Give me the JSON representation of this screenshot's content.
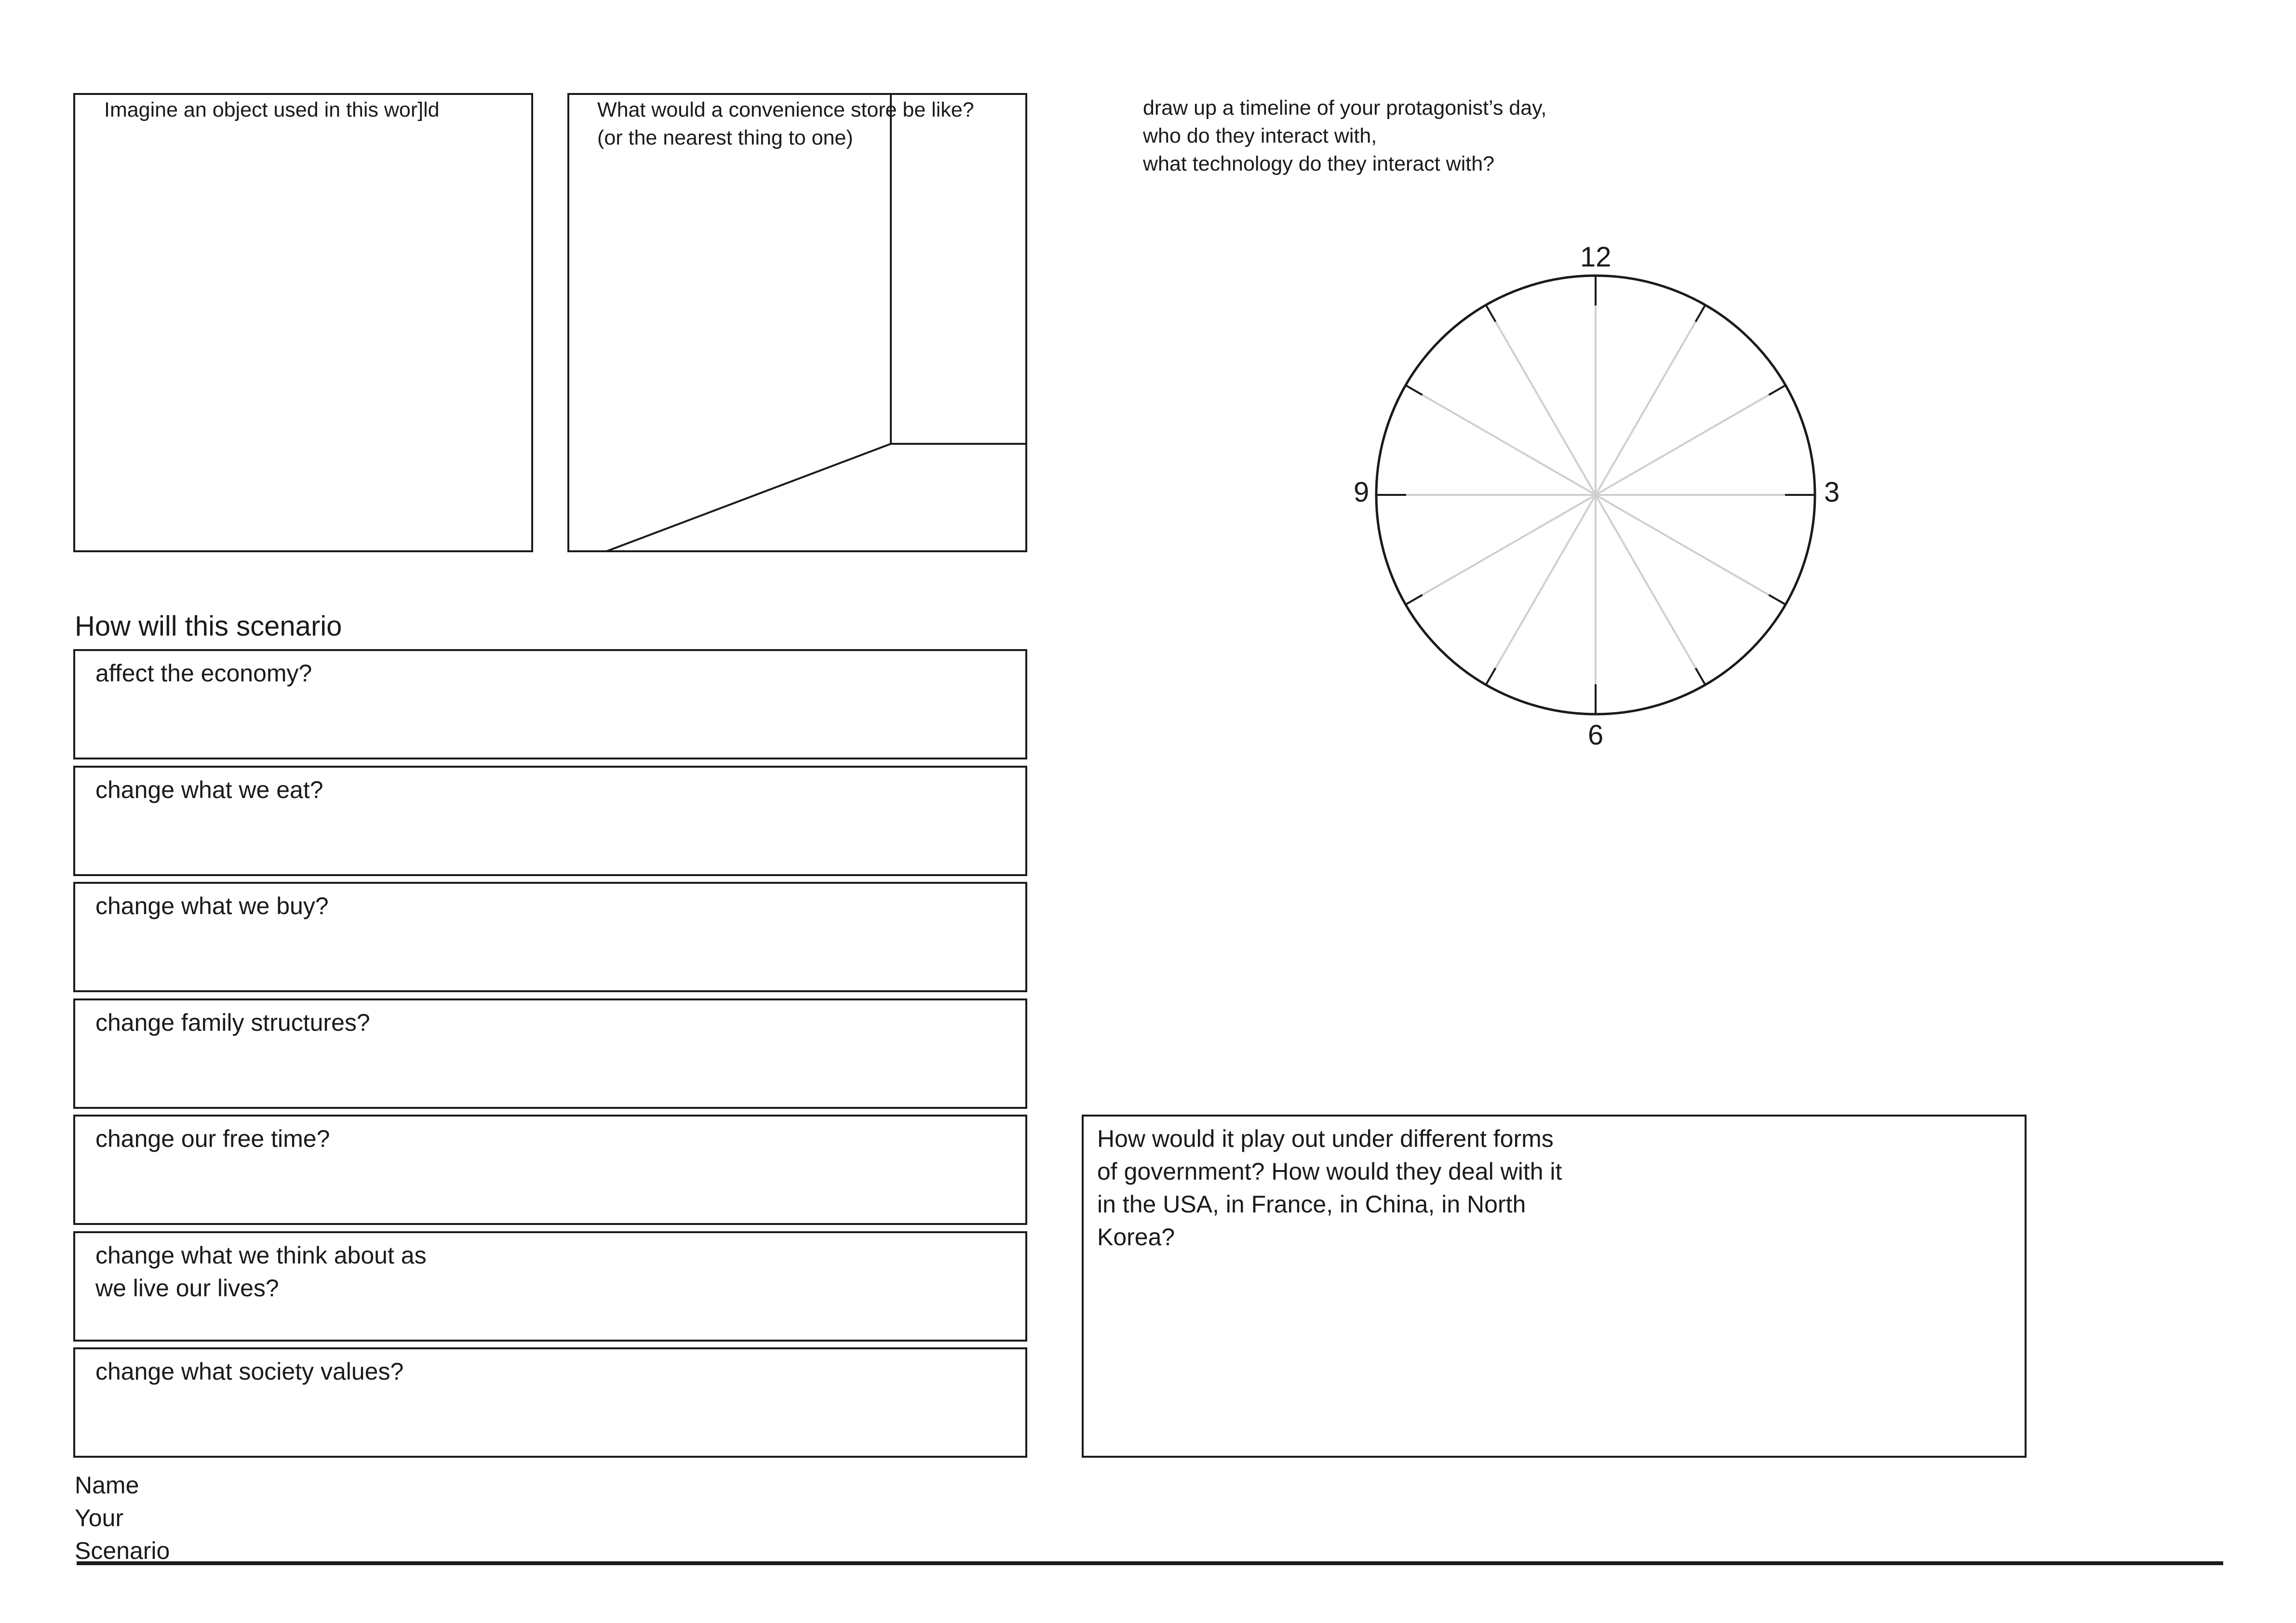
{
  "object_box": {
    "prompt": "Imagine an object used in this wor]ld"
  },
  "store_box": {
    "prompt_lines": [
      "What would a convenience store be like?",
      "(or the nearest thing to one)"
    ]
  },
  "timeline": {
    "prompt_lines": [
      "draw up a timeline of your protagonist’s day,",
      "who do they interact with,",
      "what technology do they interact with?"
    ],
    "clock_labels": {
      "top": "12",
      "right": "3",
      "bottom": "6",
      "left": "9"
    }
  },
  "scenario": {
    "heading": "How will this scenario",
    "questions": [
      {
        "lines": [
          "affect the economy?"
        ]
      },
      {
        "lines": [
          "change what we eat?"
        ]
      },
      {
        "lines": [
          "change what we buy?"
        ]
      },
      {
        "lines": [
          "change family structures?"
        ]
      },
      {
        "lines": [
          "change our free time?"
        ]
      },
      {
        "lines": [
          "change what we think about as",
          "we live our lives?"
        ]
      },
      {
        "lines": [
          "change what society values?"
        ]
      }
    ]
  },
  "government": {
    "prompt_lines": [
      "How would it play out under different forms",
      "of government? How would they deal with it",
      "in the USA, in France, in China, in North",
      "Korea?"
    ]
  },
  "footer": {
    "lines": [
      "Name",
      "Your",
      "Scenario"
    ]
  }
}
